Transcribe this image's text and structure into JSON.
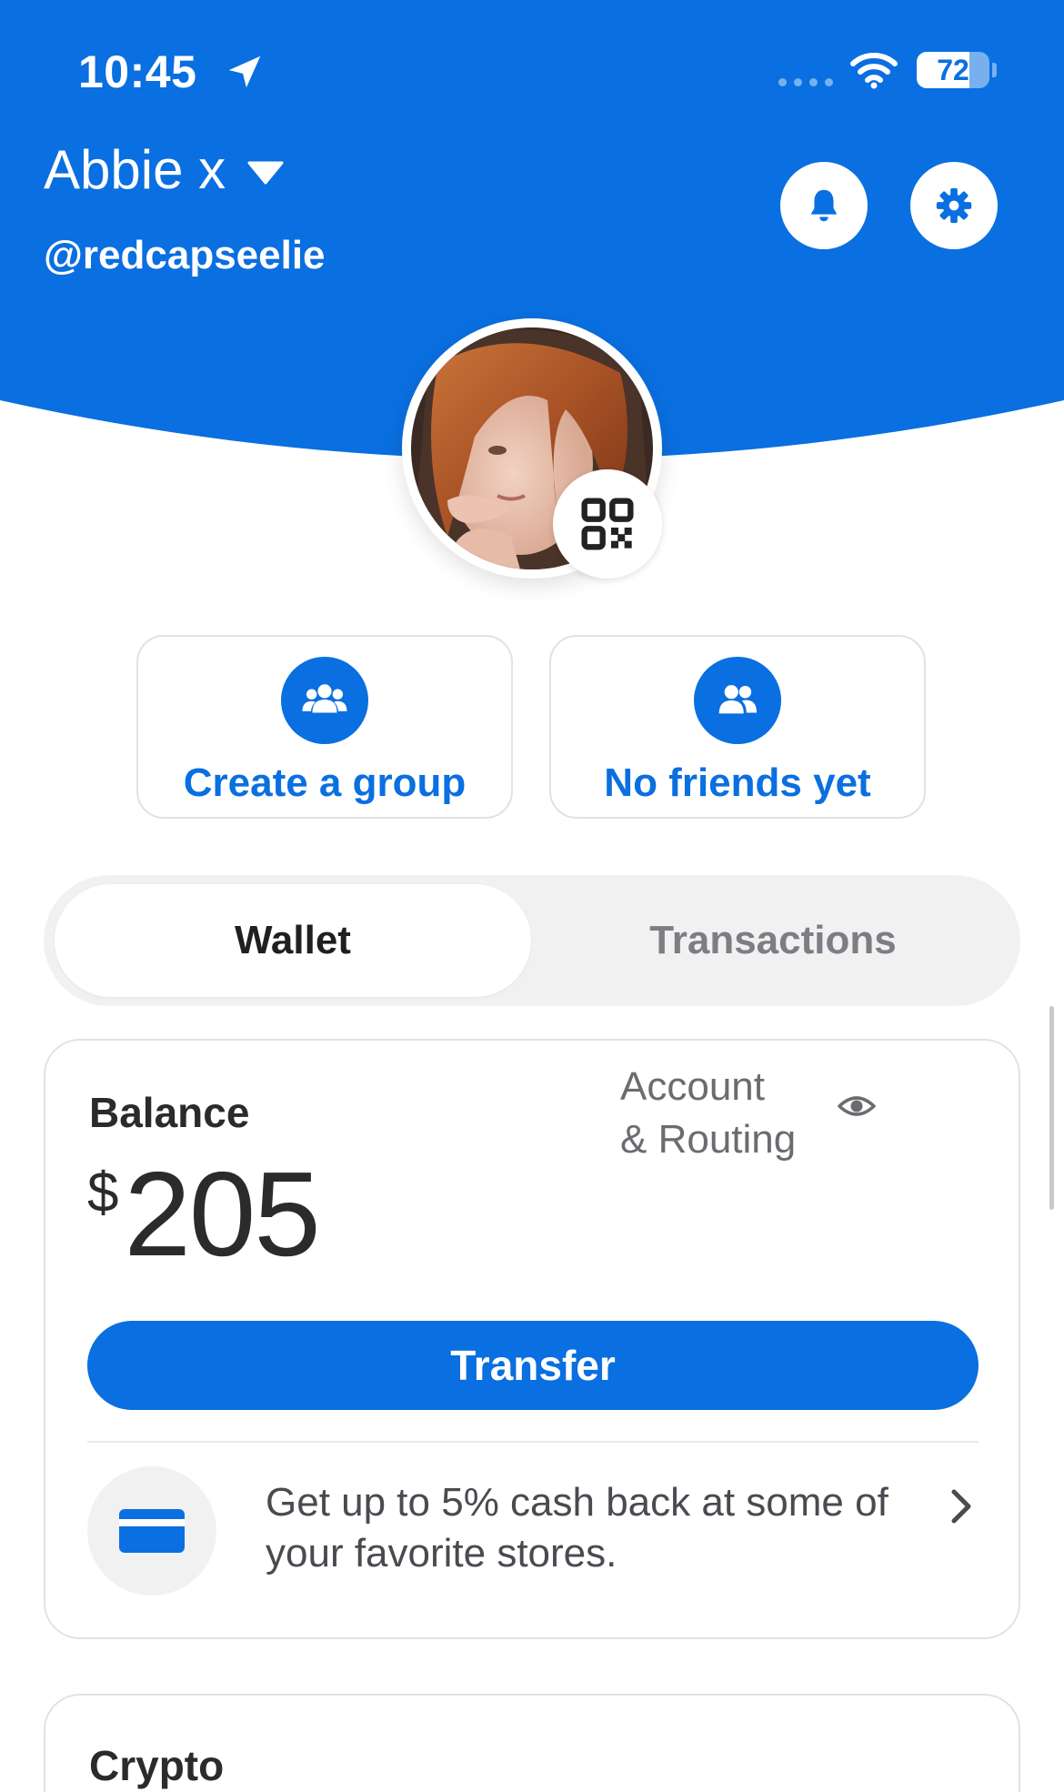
{
  "colors": {
    "brand_blue": "#0a6fe0",
    "card_border": "#e2e2e4",
    "segment_bg": "#f1f1f2",
    "muted_text": "#7d7d83"
  },
  "status_bar": {
    "time": "10:45",
    "battery": "72",
    "battery_level": 0.72,
    "icons": [
      "location-arrow-icon",
      "signal-dots-icon",
      "wifi-icon",
      "battery-icon"
    ]
  },
  "profile": {
    "name": "Abbie x",
    "handle": "@redcapseelie",
    "avatar_alt": "profile photo",
    "icons": [
      "chevron-down-icon",
      "bell-icon",
      "gear-icon",
      "qr-code-icon"
    ]
  },
  "quick_actions": [
    {
      "label": "Create a group",
      "icon": "group-icon"
    },
    {
      "label": "No friends yet",
      "icon": "friends-icon"
    }
  ],
  "tabs": {
    "selected": "Wallet",
    "items": [
      "Wallet",
      "Transactions"
    ]
  },
  "wallet": {
    "balance_label": "Balance",
    "currency_symbol": "$",
    "balance": "205",
    "account_routing": "Account\n& Routing",
    "transfer_label": "Transfer",
    "promo_text": "Get up to 5% cash back at some of your favorite stores.",
    "icons": [
      "eye-icon",
      "credit-card-icon",
      "chevron-right-icon"
    ]
  },
  "crypto": {
    "title": "Crypto"
  }
}
